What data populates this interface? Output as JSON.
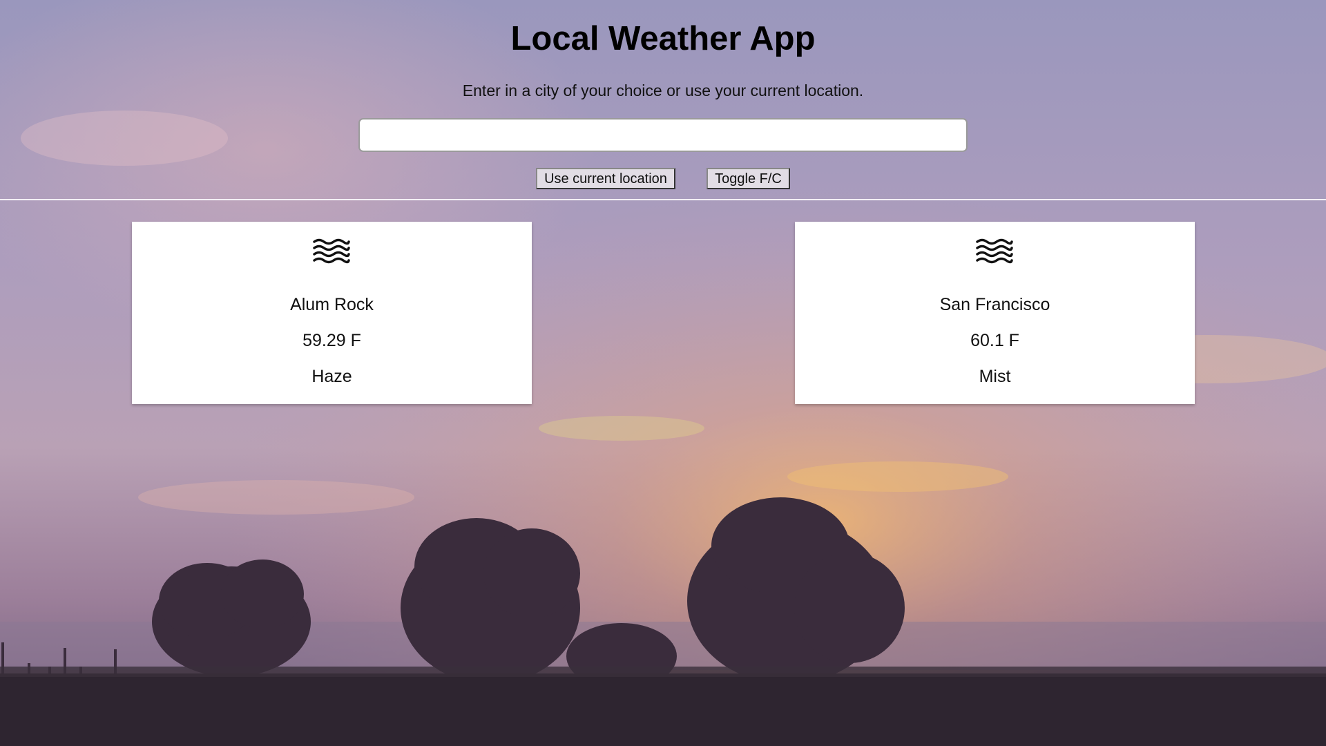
{
  "app": {
    "title": "Local Weather App",
    "subtitle": "Enter in a city of your choice or use your current location."
  },
  "search": {
    "value": "",
    "placeholder": ""
  },
  "buttons": {
    "use_location_label": "Use current location",
    "toggle_units_label": "Toggle F/C"
  },
  "cards": [
    {
      "icon": "haze-icon",
      "city": "Alum Rock",
      "temperature": "59.29 F",
      "condition": "Haze"
    },
    {
      "icon": "mist-icon",
      "city": "San Francisco",
      "temperature": "60.1 F",
      "condition": "Mist"
    }
  ],
  "colors": {
    "card_background": "#ffffff",
    "divider": "#f4f1f6",
    "sky_top": "#9a97bd",
    "sky_mid": "#b7a3bc",
    "sky_glow": "#e8b27a",
    "ground": "#2e2530"
  }
}
